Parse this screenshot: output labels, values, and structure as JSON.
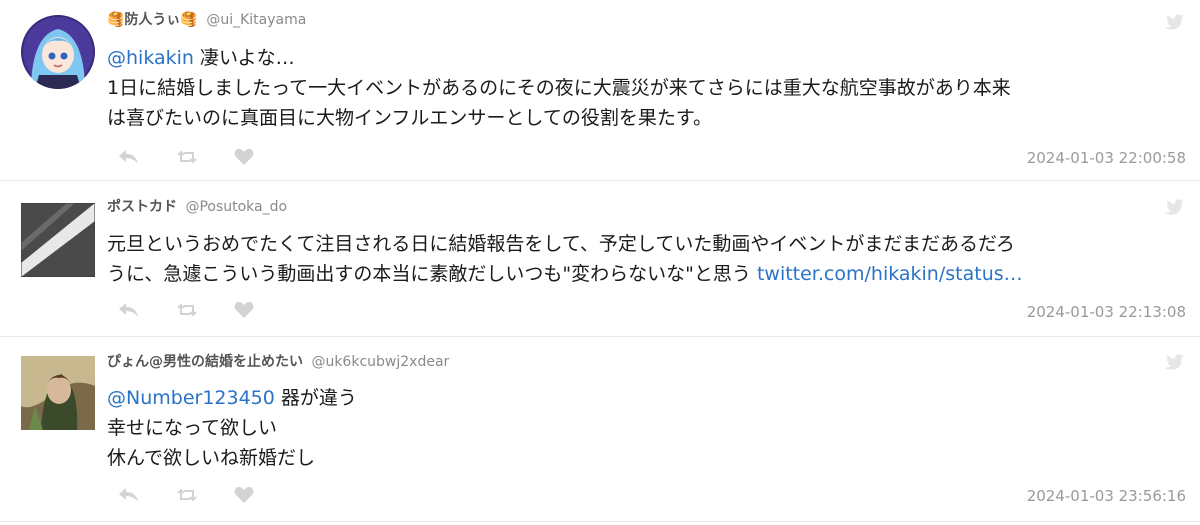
{
  "tweets": [
    {
      "name": "🥞防人うぃ🥞",
      "handle": "@ui_Kitayama",
      "lines": [
        {
          "mention": "@hikakin",
          "text": " 凄いよな…"
        },
        {
          "text": "1日に結婚しましたって一大イベントがあるのにその夜に大震災が来てさらには重大な航空事故があり本来"
        },
        {
          "text": "は喜びたいのに真面目に大物インフルエンサーとしての役割を果たす。"
        }
      ],
      "timestamp": "2024-01-03 22:00:58"
    },
    {
      "name": "ポストカド",
      "handle": "@Posutoka_do",
      "lines": [
        {
          "text": "元旦というおめでたくて注目される日に結婚報告をして、予定していた動画やイベントがまだまだあるだろ"
        },
        {
          "text": "うに、急遽こういう動画出すの本当に素敵だしいつも\"変わらないな\"と思う ",
          "link": "twitter.com/hikakin/status…"
        }
      ],
      "timestamp": "2024-01-03 22:13:08"
    },
    {
      "name": "ぴょん@男性の結婚を止めたい",
      "handle": "@uk6kcubwj2xdear",
      "lines": [
        {
          "mention": "@Number123450",
          "text": " 器が違う"
        },
        {
          "text": "幸せになって欲しい"
        },
        {
          "text": "休んで欲しいね新婚だし"
        }
      ],
      "timestamp": "2024-01-03 23:56:16"
    }
  ],
  "icons": {
    "reply": "reply-icon",
    "retweet": "retweet-icon",
    "like": "heart-icon",
    "brand": "twitter-bird-icon"
  },
  "colors": {
    "link": "#2a73c7",
    "muted": "#9a9a9a",
    "icon": "#d3d3d3"
  }
}
